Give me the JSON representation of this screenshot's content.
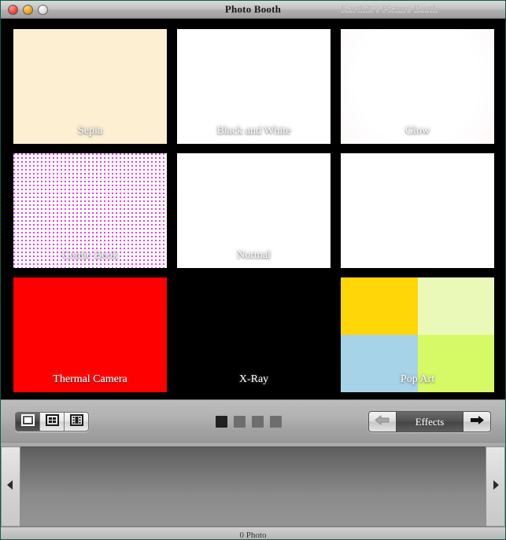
{
  "window": {
    "title": "Photo Booth",
    "subtitle": "Karthik's Picture Booth",
    "controls": {
      "close": "close-button",
      "minimize": "minimize-button",
      "zoom": "zoom-button"
    }
  },
  "effects": {
    "tiles": [
      {
        "label": "Sepia",
        "style": "fx-sepia",
        "dark": false
      },
      {
        "label": "Black and White",
        "style": "fx-bw",
        "dark": false
      },
      {
        "label": "Glow",
        "style": "fx-glow",
        "dark": false
      },
      {
        "label": "Comic Book",
        "style": "fx-comic",
        "dark": false
      },
      {
        "label": "Normal",
        "style": "fx-normal",
        "dark": false
      },
      {
        "label": "",
        "style": "fx-plain",
        "dark": false
      },
      {
        "label": "Thermal Camera",
        "style": "fx-thermal",
        "dark": true
      },
      {
        "label": "X-Ray",
        "style": "fx-xray",
        "dark": true
      },
      {
        "label": "Pop Art",
        "style": "fx-popart",
        "dark": false
      }
    ],
    "popart_quadrants": [
      "#ffd608",
      "#ebf9b8",
      "#a6d3e8",
      "#d6fa66"
    ],
    "comic_dot_color": "#e81ce8",
    "sepia_color": "#fcefd2",
    "thermal_color": "#fe0000"
  },
  "toolbar": {
    "modes": [
      {
        "name": "single-photo",
        "selected": true
      },
      {
        "name": "four-up",
        "selected": false
      },
      {
        "name": "movie",
        "selected": false
      }
    ],
    "page_dots": [
      {
        "active": true
      },
      {
        "active": false
      },
      {
        "active": false
      },
      {
        "active": false
      }
    ],
    "effects_label": "Effects",
    "prev_arrow": "arrow-left-icon",
    "next_arrow": "arrow-right-icon",
    "prev_enabled": false,
    "next_enabled": true
  },
  "tray": {
    "scroll_left": "triangle-left-icon",
    "scroll_right": "triangle-right-icon",
    "status": "0 Photo"
  }
}
